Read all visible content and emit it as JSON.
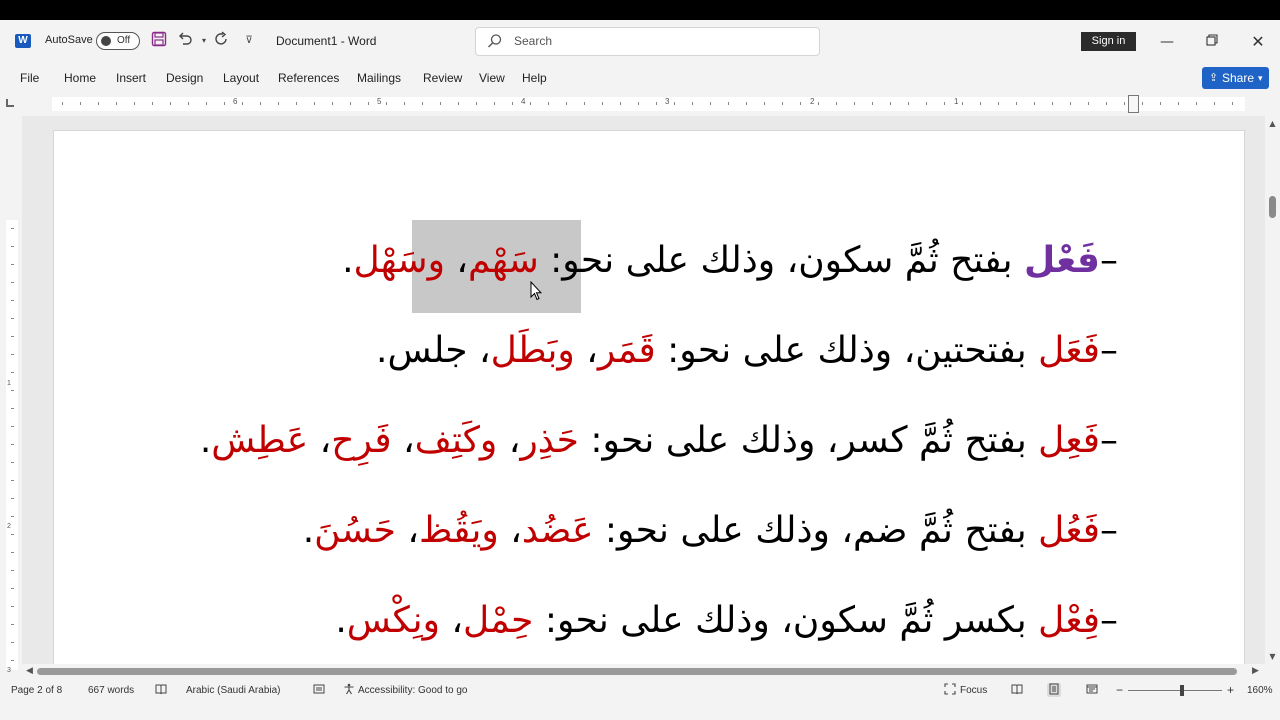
{
  "titlebar": {
    "app_icon": "word-icon",
    "app_letter": "W",
    "autosave_label": "AutoSave",
    "autosave_state": "Off",
    "document_title": "Document1  -  Word",
    "search_placeholder": "Search",
    "signin_label": "Sign in"
  },
  "ribbon": {
    "tabs": [
      "File",
      "Home",
      "Insert",
      "Design",
      "Layout",
      "References",
      "Mailings",
      "Review",
      "View",
      "Help"
    ],
    "share_label": "Share"
  },
  "ruler": {
    "numbers": [
      "6",
      "5",
      "4",
      "3",
      "2",
      "1"
    ]
  },
  "vruler": {
    "numbers": [
      "1",
      "2",
      "3"
    ]
  },
  "document": {
    "lines": [
      {
        "lead": "–",
        "word": "فَعْل",
        "rest": " بفتح ثُمَّ سكون، وذلك على نحو: ",
        "ex1": "سَهْم",
        "sep1": "، ",
        "ex2": "وسَهْل",
        "end": "."
      },
      {
        "lead": "–",
        "word": "فَعَل",
        "rest": " بفتحتين، وذلك على نحو: ",
        "ex1": "قَمَر",
        "sep1": "، ",
        "ex2": "وبَطَل",
        "sep2": "، ",
        "ex3": "جلس",
        "end": "."
      },
      {
        "lead": "–",
        "word": "فَعِل",
        "rest": " بفتح ثُمَّ كسر، وذلك على نحو: ",
        "ex1": "حَذِر",
        "sep1": "، ",
        "ex2": "وكَتِف",
        "sep2": "، ",
        "ex3": "فَرِح",
        "sep3": "، ",
        "ex4": "عَطِش",
        "end": "."
      },
      {
        "lead": "–",
        "word": "فَعُل",
        "rest": " بفتح ثُمَّ ضم، وذلك على نحو: ",
        "ex1": "عَضُد",
        "sep1": "، ",
        "ex2": "ويَقُظ",
        "sep2": "، ",
        "ex3": "حَسُنَ",
        "end": "."
      },
      {
        "lead": "–",
        "word": "فِعْل",
        "rest": " بكسر ثُمَّ سكون، وذلك على نحو: ",
        "ex1": "حِمْل",
        "sep1": "، ",
        "ex2": "ونِكْس",
        "end": "."
      }
    ]
  },
  "status": {
    "page": "Page 2 of 8",
    "words": "667 words",
    "language": "Arabic (Saudi Arabia)",
    "accessibility": "Accessibility: Good to go",
    "focus": "Focus",
    "zoom": "160%"
  },
  "colors": {
    "accent": "#1f63c6",
    "keyword_purple": "#7030a0",
    "keyword_red": "#c00000",
    "selection": "#c8c8c8"
  }
}
